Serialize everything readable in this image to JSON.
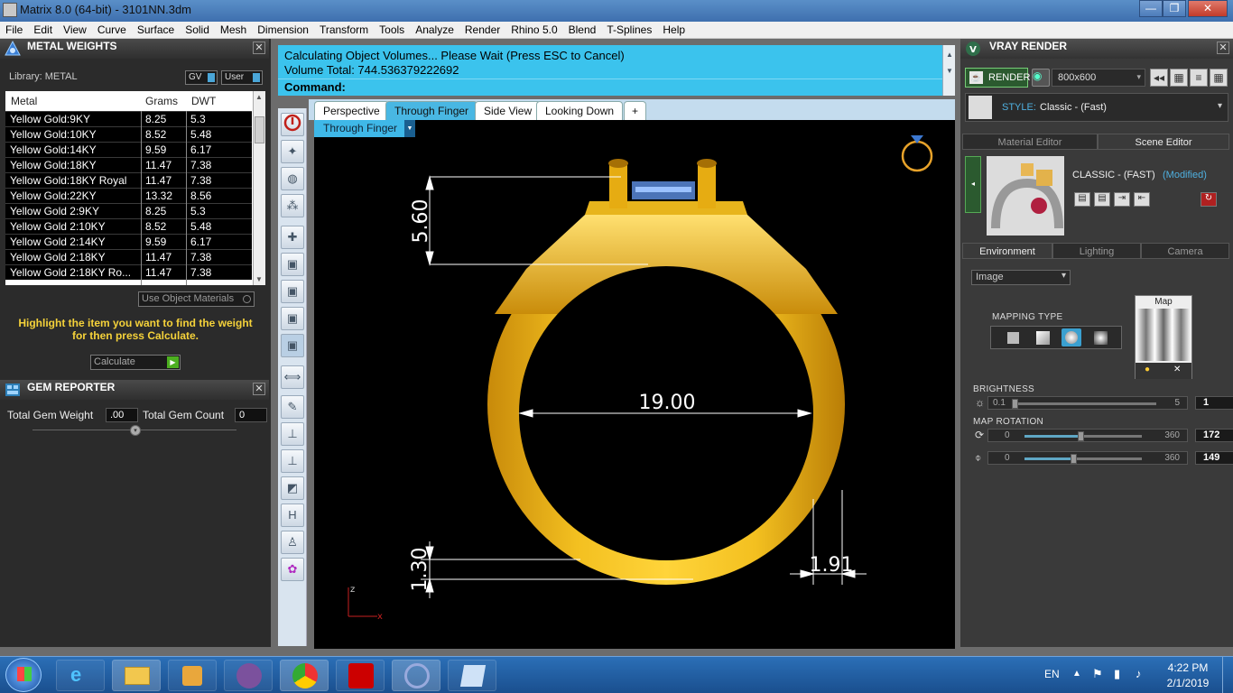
{
  "window": {
    "title": "Matrix 8.0 (64-bit) - 3101NN.3dm",
    "min": "—",
    "max": "❐",
    "close": "✕"
  },
  "menu": [
    "File",
    "Edit",
    "View",
    "Curve",
    "Surface",
    "Solid",
    "Mesh",
    "Dimension",
    "Transform",
    "Tools",
    "Analyze",
    "Render",
    "Rhino 5.0",
    "Blend",
    "T-Splines",
    "Help"
  ],
  "metal_weights": {
    "title": "METAL WEIGHTS",
    "library_label": "Library: METAL",
    "gv_label": "GV",
    "user_label": "User",
    "columns": [
      "Metal",
      "Grams",
      "DWT"
    ],
    "rows": [
      [
        "Yellow Gold:9KY",
        "8.25",
        "5.3"
      ],
      [
        "Yellow Gold:10KY",
        "8.52",
        "5.48"
      ],
      [
        "Yellow Gold:14KY",
        "9.59",
        "6.17"
      ],
      [
        "Yellow Gold:18KY",
        "11.47",
        "7.38"
      ],
      [
        "Yellow Gold:18KY Royal",
        "11.47",
        "7.38"
      ],
      [
        "Yellow Gold:22KY",
        "13.32",
        "8.56"
      ],
      [
        "Yellow Gold 2:9KY",
        "8.25",
        "5.3"
      ],
      [
        "Yellow Gold 2:10KY",
        "8.52",
        "5.48"
      ],
      [
        "Yellow Gold 2:14KY",
        "9.59",
        "6.17"
      ],
      [
        "Yellow Gold 2:18KY",
        "11.47",
        "7.38"
      ],
      [
        "Yellow Gold 2:18KY Ro...",
        "11.47",
        "7.38"
      ]
    ],
    "use_object_materials": "Use Object Materials",
    "instruction": "Highlight the item you want to find the weight for then press Calculate.",
    "calculate_label": "Calculate"
  },
  "gem_reporter": {
    "title": "GEM REPORTER",
    "total_weight_label": "Total Gem Weight",
    "total_weight_value": ".00",
    "total_count_label": "Total Gem Count",
    "total_count_value": "0"
  },
  "command": {
    "line1": "Calculating Object Volumes... Please Wait (Press ESC to Cancel)",
    "line2": "Volume Total: 744.536379222692",
    "prompt": "Command:"
  },
  "viewport_tabs": [
    {
      "label": "Perspective",
      "active": false
    },
    {
      "label": "Through Finger",
      "active": true
    },
    {
      "label": "Side View",
      "active": false
    },
    {
      "label": "Looking Down",
      "active": false
    },
    {
      "label": "+",
      "active": false
    }
  ],
  "viewport": {
    "name": "Through Finger",
    "dims": {
      "top_height": "5.60",
      "inner_diameter": "19.00",
      "bottom_thickness": "1.30",
      "side_width": "1.91"
    },
    "axis_z": "z",
    "axis_x": "x"
  },
  "vray": {
    "title": "VRAY RENDER",
    "render_label": "RENDER",
    "resolution": "800x600",
    "style_label": "STYLE:",
    "style_value": "Classic - (Fast)",
    "editor_tabs": [
      "Material Editor",
      "Scene Editor"
    ],
    "preset_name": "CLASSIC - (FAST)",
    "preset_modified": "(Modified)",
    "env_tabs": [
      "Environment",
      "Lighting",
      "Camera"
    ],
    "env_select": "Image",
    "map_label": "Map",
    "mapping_type_label": "MAPPING TYPE",
    "brightness": {
      "label": "BRIGHTNESS",
      "min": "0.1",
      "max": "5",
      "value": "1",
      "fraction": 0.02
    },
    "map_rotation": {
      "label": "MAP ROTATION",
      "h_min": "0",
      "h_max": "360",
      "h_value": "172",
      "v_min": "0",
      "v_max": "360",
      "v_value": "149"
    }
  },
  "taskbar": {
    "lang": "EN",
    "time": "4:22 PM",
    "date": "2/1/2019"
  }
}
